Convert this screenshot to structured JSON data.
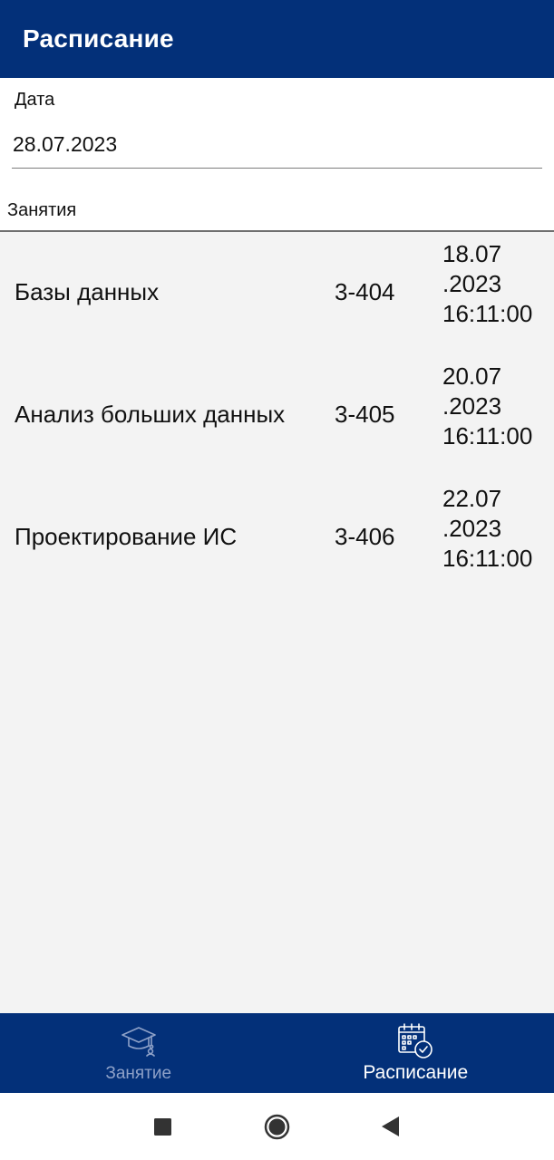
{
  "app": {
    "title": "Расписание"
  },
  "date": {
    "label": "Дата",
    "value": "28.07.2023"
  },
  "lessons": {
    "label": "Занятия",
    "items": [
      {
        "subject": "Базы данных",
        "room": "3-404",
        "date_part1": "18.07",
        "date_part2": ".2023",
        "time": "16:11:00"
      },
      {
        "subject": "Анализ больших данных",
        "room": "3-405",
        "date_part1": "20.07",
        "date_part2": ".2023",
        "time": "16:11:00"
      },
      {
        "subject": "Проектирование ИС",
        "room": "3-406",
        "date_part1": "22.07",
        "date_part2": ".2023",
        "time": "16:11:00"
      }
    ]
  },
  "bottom_nav": {
    "items": [
      {
        "label": "Занятие",
        "icon": "graduation-cap-icon",
        "active": false
      },
      {
        "label": "Расписание",
        "icon": "calendar-clock-icon",
        "active": true
      }
    ]
  },
  "colors": {
    "primary": "#033079",
    "inactive_tab": "#8ea1c8",
    "list_bg": "#f3f3f3"
  },
  "system_nav": {
    "icons": [
      "recents-square-icon",
      "home-circle-icon",
      "back-triangle-icon"
    ]
  }
}
